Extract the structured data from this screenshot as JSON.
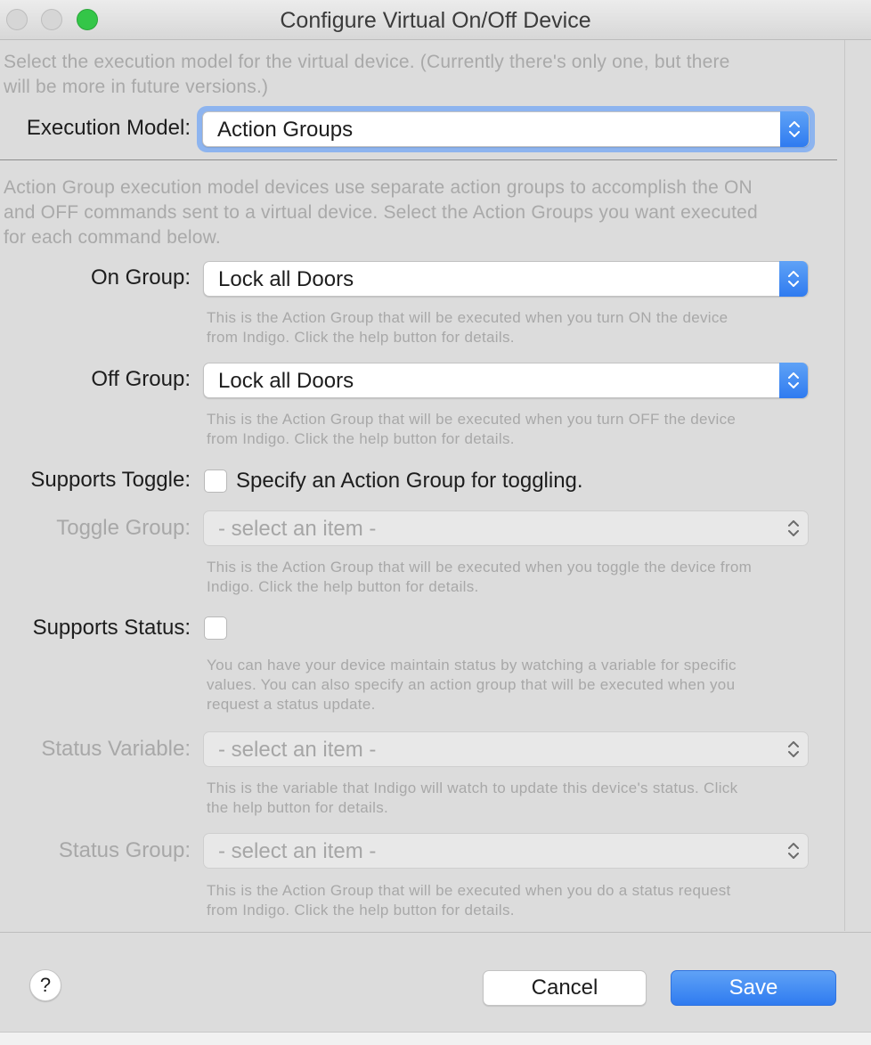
{
  "window": {
    "title": "Configure Virtual On/Off Device"
  },
  "intro": {
    "line1": "Select the execution model for the virtual device. (Currently there's only one, but there",
    "line2": "will be more in future versions.)"
  },
  "execution_model": {
    "label": "Execution Model:",
    "value": "Action Groups"
  },
  "action_group_desc": {
    "line1": "Action Group execution model devices use separate action groups to accomplish the ON",
    "line2": "and OFF commands sent to a virtual device. Select the Action Groups you want executed",
    "line3": "for each command below."
  },
  "on_group": {
    "label": "On Group:",
    "value": "Lock all Doors",
    "help1": "This is the Action Group that will be executed when you turn ON the device",
    "help2": "from Indigo. Click the help button for details."
  },
  "off_group": {
    "label": "Off Group:",
    "value": "Lock all Doors",
    "help1": "This is the Action Group that will be executed when you turn OFF the device",
    "help2": "from Indigo. Click the help button for details."
  },
  "supports_toggle": {
    "label": "Supports Toggle:",
    "checkbox_text": "Specify an Action Group for toggling.",
    "checked": false
  },
  "toggle_group": {
    "label": "Toggle Group:",
    "value": "- select an item -",
    "help1": "This is the Action Group that will be executed when you toggle the device from",
    "help2": "Indigo. Click the help button for details."
  },
  "supports_status": {
    "label": "Supports Status:",
    "checked": false,
    "help1": "You can have your device maintain status by watching a variable for specific",
    "help2": "values. You can also specify an action group that will be executed when you",
    "help3": "request a status update."
  },
  "status_variable": {
    "label": "Status Variable:",
    "value": "- select an item -",
    "help1": "This is the variable that Indigo will watch to update this device's status. Click",
    "help2": "the help button for details."
  },
  "status_group": {
    "label": "Status Group:",
    "value": "- select an item -",
    "help1": "This is the Action Group that will be executed when you do a status request",
    "help2": "from Indigo. Click the help button for details."
  },
  "footer": {
    "help_label": "?",
    "cancel_label": "Cancel",
    "save_label": "Save"
  },
  "colors": {
    "accent": "#3478f6",
    "traffic_green": "#34c648",
    "dialog_bg": "#dcdcdc"
  }
}
